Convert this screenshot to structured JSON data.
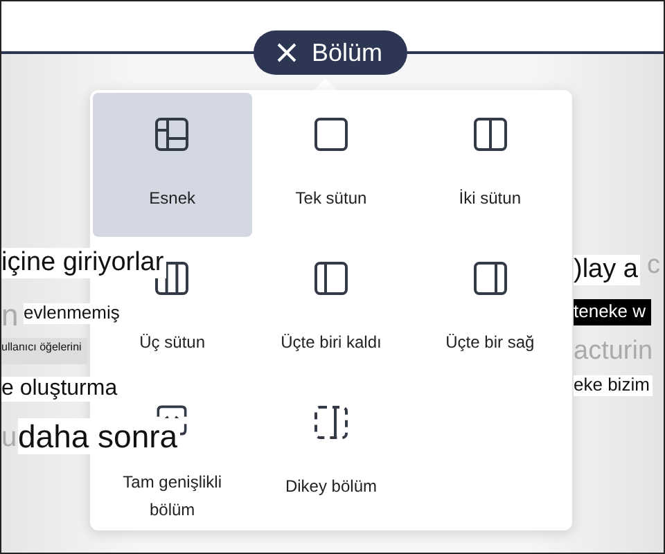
{
  "section_button": {
    "label": "Bölüm"
  },
  "layouts": [
    {
      "kind": "flexible",
      "label": "Esnek",
      "selected": true
    },
    {
      "kind": "one-column",
      "label": "Tek sütun",
      "selected": false
    },
    {
      "kind": "two-columns",
      "label": "İki sütun",
      "selected": false
    },
    {
      "kind": "three-columns",
      "label": "Üç sütun",
      "selected": false
    },
    {
      "kind": "third-left",
      "label": "Üçte biri kaldı",
      "selected": false
    },
    {
      "kind": "third-right",
      "label": "Üçte bir sağ",
      "selected": false
    },
    {
      "kind": "full-width",
      "label": "Tam genişlikli bölüm",
      "selected": false
    },
    {
      "kind": "vertical",
      "label": "Dikey bölüm",
      "selected": false
    }
  ],
  "background_fragments": [
    {
      "kind": "heading",
      "text": "içine giriyorlar"
    },
    {
      "kind": "faded",
      "text": "n"
    },
    {
      "kind": "body",
      "text": "evlenmemiş"
    },
    {
      "kind": "tiny",
      "text": "ullanıcı öğelerini"
    },
    {
      "kind": "heading",
      "text": "e oluşturma"
    },
    {
      "kind": "faded",
      "text": "u"
    },
    {
      "kind": "large",
      "text": "daha sonra"
    },
    {
      "kind": "heading",
      "text": ")lay a"
    },
    {
      "kind": "faded",
      "text": "c"
    },
    {
      "kind": "inverted",
      "text": "teneke w"
    },
    {
      "kind": "faded",
      "text": "acturin"
    },
    {
      "kind": "body",
      "text": "eke bizim"
    }
  ]
}
